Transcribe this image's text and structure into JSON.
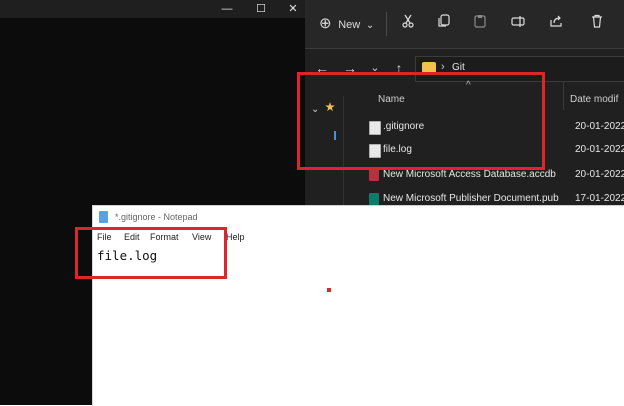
{
  "console": {
    "controls": [
      "—",
      "☐",
      "✕"
    ]
  },
  "explorer": {
    "toolbar": {
      "new_label": "New",
      "new_icon": "⊕",
      "new_chevron": "⌄",
      "icons": [
        "scissors-icon",
        "copy-icon",
        "paste-icon",
        "rename-icon",
        "share-icon",
        "delete-icon"
      ]
    },
    "nav": {
      "back": "←",
      "forward": "→",
      "recent": "⌄",
      "up": "↑",
      "breadcrumb_sep": "›",
      "folder": "Git"
    },
    "columns": {
      "name": "Name",
      "date": "Date modif"
    },
    "files": [
      {
        "name": ".gitignore",
        "date": "20-01-2022",
        "icon": "text-file-icon",
        "color": "#e8e8e8"
      },
      {
        "name": "file.log",
        "date": "20-01-2022",
        "icon": "text-file-icon",
        "color": "#e8e8e8"
      },
      {
        "name": "New Microsoft Access Database.accdb",
        "date": "20-01-2022",
        "icon": "access-icon",
        "color": "#b7323e"
      },
      {
        "name": "New Microsoft Publisher Document.pub",
        "date": "17-01-2022",
        "icon": "publisher-icon",
        "color": "#0f7b6c"
      }
    ]
  },
  "notepad": {
    "title": "*.gitignore - Notepad",
    "menu": [
      "File",
      "Edit",
      "Format",
      "View",
      "Help"
    ],
    "content": "file.log"
  },
  "colors": {
    "highlight": "#e0242c",
    "folder": "#f2c14e"
  }
}
